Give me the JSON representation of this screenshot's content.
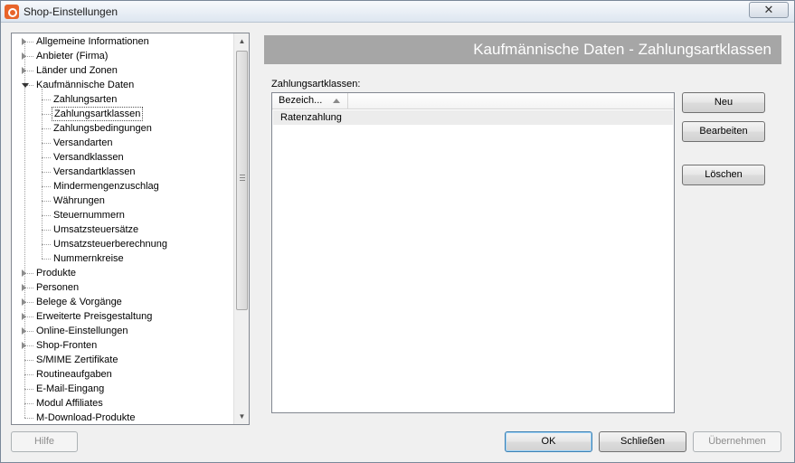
{
  "window": {
    "title": "Shop-Einstellungen",
    "close_glyph": "✕"
  },
  "tree": {
    "items": [
      {
        "label": "Allgemeine Informationen",
        "level": 0,
        "expander": "closed"
      },
      {
        "label": "Anbieter (Firma)",
        "level": 0,
        "expander": "closed"
      },
      {
        "label": "Länder und Zonen",
        "level": 0,
        "expander": "closed"
      },
      {
        "label": "Kaufmännische Daten",
        "level": 0,
        "expander": "open"
      },
      {
        "label": "Zahlungsarten",
        "level": 1
      },
      {
        "label": "Zahlungsartklassen",
        "level": 1,
        "selected": true
      },
      {
        "label": "Zahlungsbedingungen",
        "level": 1
      },
      {
        "label": "Versandarten",
        "level": 1
      },
      {
        "label": "Versandklassen",
        "level": 1
      },
      {
        "label": "Versandartklassen",
        "level": 1
      },
      {
        "label": "Mindermengenzuschlag",
        "level": 1
      },
      {
        "label": "Währungen",
        "level": 1
      },
      {
        "label": "Steuernummern",
        "level": 1
      },
      {
        "label": "Umsatzsteuersätze",
        "level": 1
      },
      {
        "label": "Umsatzsteuerberechnung",
        "level": 1
      },
      {
        "label": "Nummernkreise",
        "level": 1
      },
      {
        "label": "Produkte",
        "level": 0,
        "expander": "closed"
      },
      {
        "label": "Personen",
        "level": 0,
        "expander": "closed"
      },
      {
        "label": "Belege & Vorgänge",
        "level": 0,
        "expander": "closed"
      },
      {
        "label": "Erweiterte Preisgestaltung",
        "level": 0,
        "expander": "closed"
      },
      {
        "label": "Online-Einstellungen",
        "level": 0,
        "expander": "closed"
      },
      {
        "label": "Shop-Fronten",
        "level": 0,
        "expander": "closed"
      },
      {
        "label": "S/MIME Zertifikate",
        "level": 0
      },
      {
        "label": "Routineaufgaben",
        "level": 0
      },
      {
        "label": "E-Mail-Eingang",
        "level": 0
      },
      {
        "label": "Modul Affiliates",
        "level": 0
      },
      {
        "label": "M-Download-Produkte",
        "level": 0
      }
    ],
    "scroll_up_glyph": "▲",
    "scroll_down_glyph": "▼"
  },
  "panel": {
    "header": "Kaufmännische Daten - Zahlungsartklassen",
    "list_caption": "Zahlungsartklassen:",
    "column_header": "Bezeich...",
    "rows": [
      "Ratenzahlung"
    ]
  },
  "buttons": {
    "new": "Neu",
    "edit": "Bearbeiten",
    "delete": "Löschen",
    "help": "Hilfe",
    "ok": "OK",
    "close": "Schließen",
    "apply": "Übernehmen"
  }
}
